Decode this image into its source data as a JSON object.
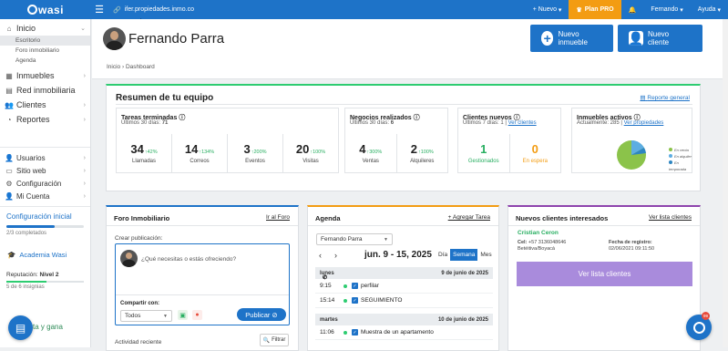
{
  "topbar": {
    "logo": "wasi",
    "url": "ifer.propiedades.inmo.co",
    "new_label": "Nuevo",
    "plan_label": "Plan PRO",
    "user_label": "Fernando",
    "help_label": "Ayuda",
    "brand_color": "#1e73c8",
    "plan_color": "#f39c12"
  },
  "sidebar": {
    "inicio": "Inicio",
    "sub": [
      "Escritorio",
      "Foro inmobiliario",
      "Agenda"
    ],
    "items": [
      "Inmuebles",
      "Red inmobiliaria",
      "Clientes",
      "Reportes"
    ],
    "items2": [
      "Usuarios",
      "Sitio web",
      "Configuración",
      "Mi Cuenta"
    ],
    "config_title": "Configuración inicial",
    "config_sub": "2/3 completados",
    "academia": "Academia Wasi",
    "reputacion": "Reputación: ",
    "reputacion_level": "Nivel 2",
    "insignias": "5 de 6 insignias",
    "gana": "ta y gana"
  },
  "header": {
    "user_name": "Fernando Parra",
    "btn_inmueble": "Nuevo inmueble",
    "btn_cliente": "Nuevo cliente",
    "breadcrumb_1": "Inicio",
    "breadcrumb_2": "Dashboard"
  },
  "resumen": {
    "title": "Resumen de tu equipo",
    "link": "Reporte general",
    "tareas": {
      "title": "Tareas terminadas",
      "sub_label": "Últimos 30 días:",
      "sub_value": "71",
      "cols": [
        {
          "num": "34",
          "pct": "42%",
          "label": "Llamadas"
        },
        {
          "num": "14",
          "pct": "134%",
          "label": "Correos"
        },
        {
          "num": "3",
          "pct": "200%",
          "label": "Eventos"
        },
        {
          "num": "20",
          "pct": "100%",
          "label": "Visitas"
        }
      ]
    },
    "negocios": {
      "title": "Negocios realizados",
      "sub_label": "Últimos 30 días:",
      "sub_value": "6",
      "cols": [
        {
          "num": "4",
          "pct": "300%",
          "label": "Ventas"
        },
        {
          "num": "2",
          "pct": "100%",
          "label": "Alquileres"
        }
      ]
    },
    "clientes": {
      "title": "Clientes nuevos",
      "sub_label": "Últimos 7 días: 1",
      "sub_link": "Ver clientes",
      "gestionados": "1",
      "gestionados_label": "Gestionados",
      "espera": "0",
      "espera_label": "En espera"
    },
    "inmuebles": {
      "title": "Inmuebles activos",
      "sub_label": "Actualmente: 285",
      "sub_link": "Ver propiedades",
      "legend": [
        "En venta",
        "En alquiler",
        "En temporada"
      ]
    }
  },
  "foro": {
    "title": "Foro Inmobiliario",
    "link": "Ir al Foro",
    "crear": "Crear publicación:",
    "placeholder": "¿Qué necesitas o estás ofreciendo?",
    "compartir": "Compartir con:",
    "compartir_value": "Todos",
    "publicar": "Publicar",
    "actividad": "Actividad reciente",
    "filtrar": "Filtrar"
  },
  "agenda": {
    "title": "Agenda",
    "link": "+ Agregar Tarea",
    "agent": "Fernando Parra",
    "week": "jun. 9 - 15, 2025",
    "views": [
      "Día",
      "Semana",
      "Mes"
    ],
    "days": [
      {
        "name": "lunes",
        "date": "9 de junio de 2025",
        "events": [
          {
            "time": "9:15",
            "text": "perfilar"
          },
          {
            "time": "15:14",
            "text": "SEGUIMIENTO"
          }
        ]
      },
      {
        "name": "martes",
        "date": "10 de junio de 2025",
        "events": [
          {
            "time": "11:06",
            "text": "Muestra de un apartamento"
          }
        ]
      }
    ]
  },
  "nuevos": {
    "title": "Nuevos clientes interesados",
    "link": "Ver lista clientes",
    "client_name": "Cristian Ceron",
    "cel_label": "Cel: ",
    "cel_value": "+57 3136048646",
    "city": "Betéitiva/Boyacá",
    "reg_label": "Fecha de registro:",
    "reg_value": "02/06/2021 09:11:50",
    "btn": "Ver lista clientes"
  },
  "notification_count": "99"
}
